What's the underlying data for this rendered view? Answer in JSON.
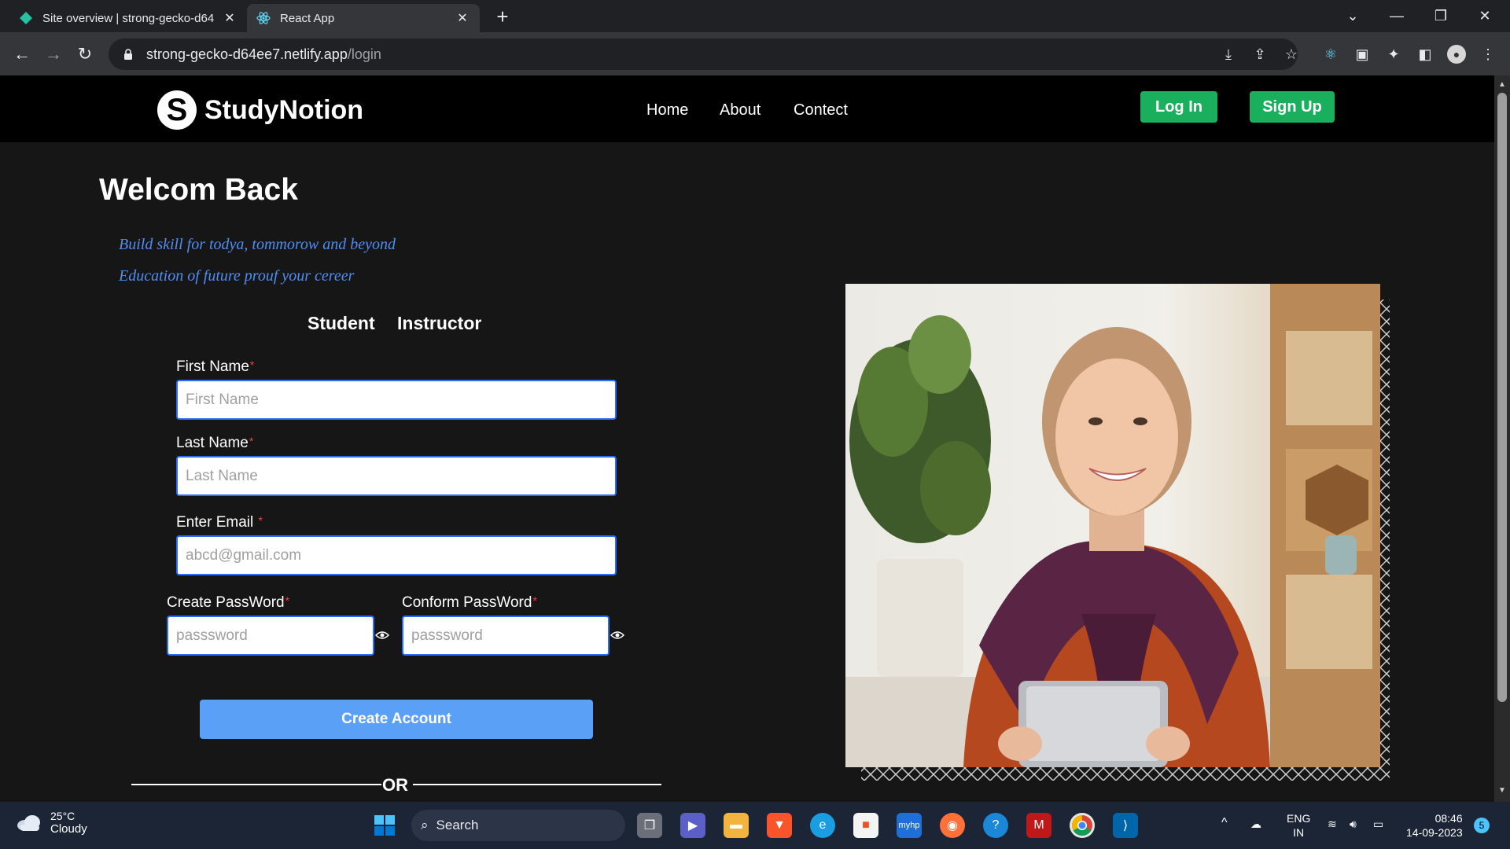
{
  "browser": {
    "tabs": [
      {
        "title": "Site overview | strong-gecko-d64",
        "active": false
      },
      {
        "title": "React App",
        "active": true
      }
    ],
    "url_host": "strong-gecko-d64ee7.netlify.app",
    "url_path": "/login"
  },
  "site": {
    "logo_letter": "S",
    "brand": "StudyNotion",
    "nav": [
      "Home",
      "About",
      "Contect"
    ],
    "login_label": "Log In",
    "signup_label": "Sign Up"
  },
  "form": {
    "heading": "Welcom Back",
    "tagline_1": "Build skill for todya, tommorow and beyond",
    "tagline_2": "Education of future prouf your cereer",
    "roles": [
      "Student",
      "Instructor"
    ],
    "first_name_label": "First Name",
    "first_name_placeholder": "First Name",
    "last_name_label": "Last Name",
    "last_name_placeholder": "Last Name",
    "email_label": "Enter Email",
    "email_placeholder": "abcd@gmail.com",
    "password_label": "Create PassWord",
    "password_placeholder": "passsword",
    "confirm_label": "Conform PassWord",
    "confirm_placeholder": "passsword",
    "required_mark": "*",
    "submit_label": "Create Account",
    "or_label": "OR"
  },
  "taskbar": {
    "temperature": "25°C",
    "condition": "Cloudy",
    "search_label": "Search",
    "lang_1": "ENG",
    "lang_2": "IN",
    "time": "08:46",
    "date": "14-09-2023",
    "notifications": "5"
  },
  "colors": {
    "accent_green": "#1aaf5d",
    "accent_blue": "#5aa0f7",
    "tagline_blue": "#4f8df5"
  }
}
